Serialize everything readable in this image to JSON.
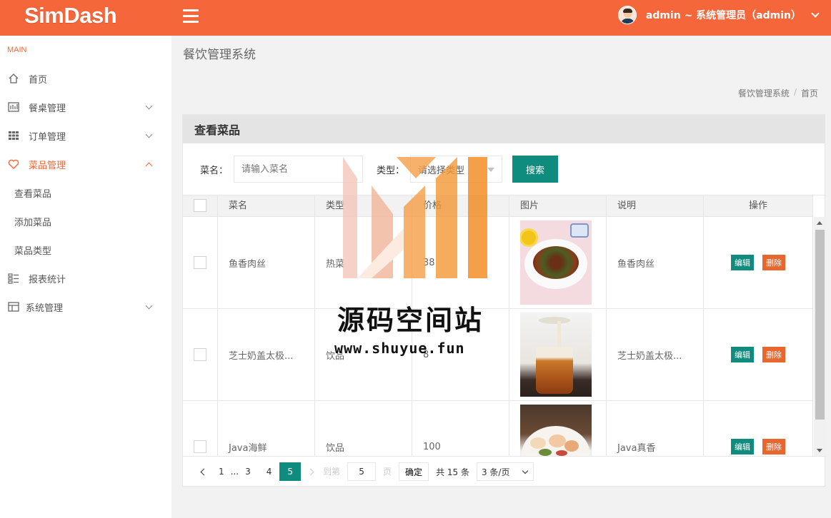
{
  "header": {
    "logo": "SimDash",
    "user_label": "admin ~ 系统管理员（admin）"
  },
  "sidebar": {
    "section_label": "MAIN",
    "items": [
      {
        "label": "首页",
        "icon": "home-icon",
        "has_arrow": false
      },
      {
        "label": "餐桌管理",
        "icon": "table-icon",
        "has_arrow": true
      },
      {
        "label": "订单管理",
        "icon": "grid-icon",
        "has_arrow": true
      },
      {
        "label": "菜品管理",
        "icon": "heart-icon",
        "has_arrow": true,
        "active": true
      },
      {
        "label": "报表统计",
        "icon": "report-icon",
        "has_arrow": false
      },
      {
        "label": "系统管理",
        "icon": "layout-icon",
        "has_arrow": true
      }
    ],
    "sub_items": [
      "查看菜品",
      "添加菜品",
      "菜品类型"
    ]
  },
  "page": {
    "title": "餐饮管理系统",
    "breadcrumb": [
      "餐饮管理系统",
      "首页"
    ]
  },
  "panel": {
    "title": "查看菜品",
    "search": {
      "name_label": "菜名：",
      "name_placeholder": "请输入菜名",
      "type_label": "类型：",
      "type_placeholder": "请选择类型",
      "button": "搜索"
    },
    "columns": [
      "菜名",
      "类型",
      "价格",
      "图片",
      "说明",
      "操作"
    ],
    "rows": [
      {
        "name": "鱼香肉丝",
        "type": "热菜",
        "price": "38",
        "desc": "鱼香肉丝"
      },
      {
        "name": "芝士奶盖太极...",
        "type": "饮品",
        "price": "8",
        "desc": "芝士奶盖太极..."
      },
      {
        "name": "Java海鲜",
        "type": "饮品",
        "price": "100",
        "desc": "Java真香"
      }
    ],
    "edit_label": "编辑",
    "delete_label": "删除"
  },
  "pagination": {
    "pages": [
      "1",
      "...",
      "3",
      "4",
      "5"
    ],
    "current": "5",
    "goto_label": "到第",
    "goto_value": "5",
    "page_unit": "页",
    "confirm": "确定",
    "total": "共 15 条",
    "page_size": "3 条/页"
  },
  "watermark": {
    "title": "源码空间站",
    "url": "www.shuyue.fun"
  },
  "colors": {
    "brand": "#f5673a",
    "primary": "#0f8c7e",
    "danger": "#e8672f"
  }
}
